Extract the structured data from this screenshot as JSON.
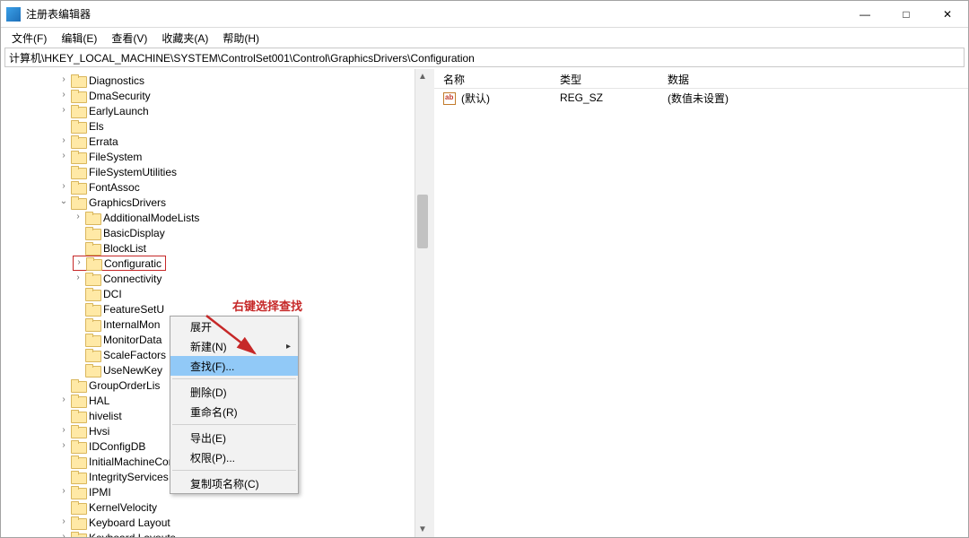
{
  "window": {
    "title": "注册表编辑器"
  },
  "win_controls": {
    "min": "—",
    "max": "□",
    "close": "✕"
  },
  "menu": {
    "file": "文件(F)",
    "edit": "编辑(E)",
    "view": "查看(V)",
    "favorites": "收藏夹(A)",
    "help": "帮助(H)"
  },
  "address": "计算机\\HKEY_LOCAL_MACHINE\\SYSTEM\\ControlSet001\\Control\\GraphicsDrivers\\Configuration",
  "annotation": "右键选择查找",
  "tree": [
    {
      "indent": 4,
      "exp": "›",
      "label": "Diagnostics"
    },
    {
      "indent": 4,
      "exp": "›",
      "label": "DmaSecurity"
    },
    {
      "indent": 4,
      "exp": "›",
      "label": "EarlyLaunch"
    },
    {
      "indent": 4,
      "exp": "",
      "label": "Els"
    },
    {
      "indent": 4,
      "exp": "›",
      "label": "Errata"
    },
    {
      "indent": 4,
      "exp": "›",
      "label": "FileSystem"
    },
    {
      "indent": 4,
      "exp": "",
      "label": "FileSystemUtilities"
    },
    {
      "indent": 4,
      "exp": "›",
      "label": "FontAssoc"
    },
    {
      "indent": 4,
      "exp": "⌄",
      "label": "GraphicsDrivers",
      "expanded": true
    },
    {
      "indent": 5,
      "exp": "›",
      "label": "AdditionalModeLists"
    },
    {
      "indent": 5,
      "exp": "",
      "label": "BasicDisplay"
    },
    {
      "indent": 5,
      "exp": "",
      "label": "BlockList"
    },
    {
      "indent": 5,
      "exp": "›",
      "label": "Configuratic",
      "selected": true
    },
    {
      "indent": 5,
      "exp": "›",
      "label": "Connectivity"
    },
    {
      "indent": 5,
      "exp": "",
      "label": "DCI"
    },
    {
      "indent": 5,
      "exp": "",
      "label": "FeatureSetU"
    },
    {
      "indent": 5,
      "exp": "",
      "label": "InternalMon"
    },
    {
      "indent": 5,
      "exp": "",
      "label": "MonitorData"
    },
    {
      "indent": 5,
      "exp": "",
      "label": "ScaleFactors"
    },
    {
      "indent": 5,
      "exp": "",
      "label": "UseNewKey"
    },
    {
      "indent": 4,
      "exp": "",
      "label": "GroupOrderLis"
    },
    {
      "indent": 4,
      "exp": "›",
      "label": "HAL"
    },
    {
      "indent": 4,
      "exp": "",
      "label": "hivelist"
    },
    {
      "indent": 4,
      "exp": "›",
      "label": "Hvsi"
    },
    {
      "indent": 4,
      "exp": "›",
      "label": "IDConfigDB"
    },
    {
      "indent": 4,
      "exp": "",
      "label": "InitialMachineConfig"
    },
    {
      "indent": 4,
      "exp": "",
      "label": "IntegrityServices"
    },
    {
      "indent": 4,
      "exp": "›",
      "label": "IPMI"
    },
    {
      "indent": 4,
      "exp": "",
      "label": "KernelVelocity"
    },
    {
      "indent": 4,
      "exp": "›",
      "label": "Keyboard Layout"
    },
    {
      "indent": 4,
      "exp": "›",
      "label": "Keyboard Layouts"
    }
  ],
  "context_menu": {
    "expand": "展开",
    "new": "新建(N)",
    "find": "查找(F)...",
    "delete": "删除(D)",
    "rename": "重命名(R)",
    "export": "导出(E)",
    "permissions": "权限(P)...",
    "copy_key_name": "复制项名称(C)"
  },
  "list": {
    "headers": {
      "name": "名称",
      "type": "类型",
      "data": "数据"
    },
    "rows": [
      {
        "name": "(默认)",
        "type": "REG_SZ",
        "data": "(数值未设置)"
      }
    ]
  }
}
